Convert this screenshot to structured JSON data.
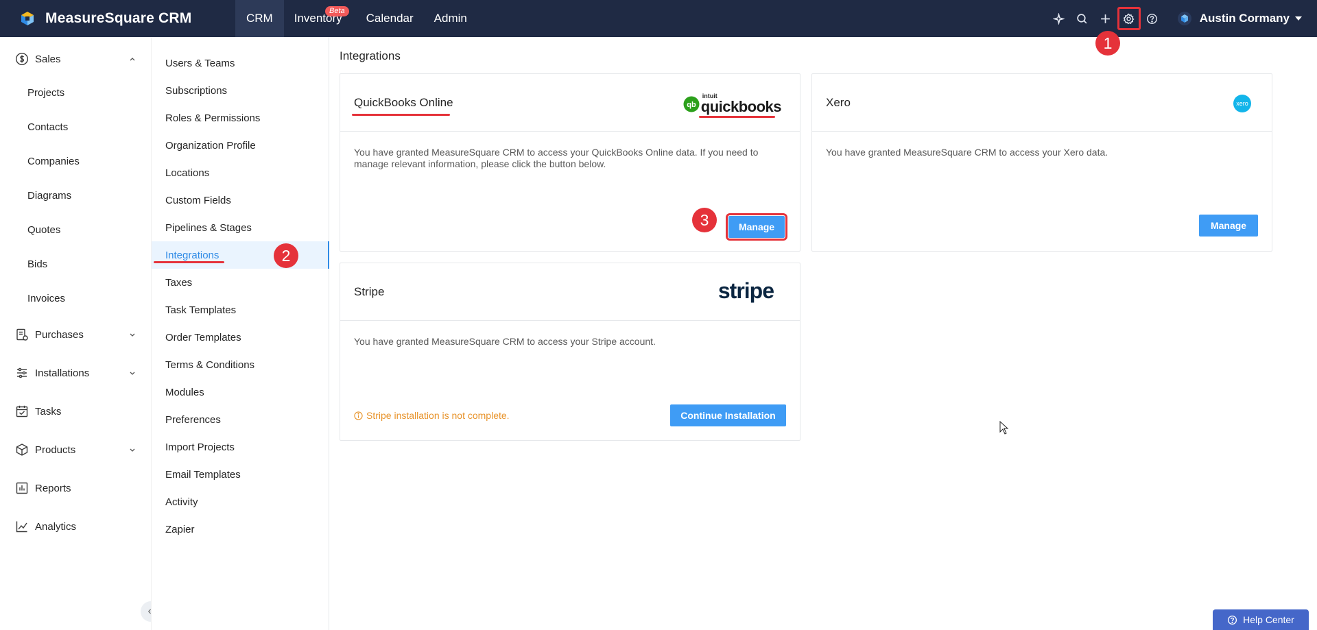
{
  "app": {
    "title": "MeasureSquare CRM"
  },
  "topnav": {
    "items": [
      "CRM",
      "Inventory",
      "Calendar",
      "Admin"
    ],
    "beta_badge": "Beta"
  },
  "user": {
    "name": "Austin Cormany"
  },
  "steps": [
    "1",
    "2",
    "3"
  ],
  "sidebar": {
    "sales": "Sales",
    "sales_items": [
      "Projects",
      "Contacts",
      "Companies",
      "Diagrams",
      "Quotes",
      "Bids",
      "Invoices"
    ],
    "purchases": "Purchases",
    "installations": "Installations",
    "tasks": "Tasks",
    "products": "Products",
    "reports": "Reports",
    "analytics": "Analytics"
  },
  "settings_menu": {
    "items": [
      "Users & Teams",
      "Subscriptions",
      "Roles & Permissions",
      "Organization Profile",
      "Locations",
      "Custom Fields",
      "Pipelines & Stages",
      "Integrations",
      "Taxes",
      "Task Templates",
      "Order Templates",
      "Terms & Conditions",
      "Modules",
      "Preferences",
      "Import Projects",
      "Email Templates",
      "Activity",
      "Zapier"
    ],
    "active": "Integrations"
  },
  "main": {
    "title": "Integrations",
    "quickbooks": {
      "title": "QuickBooks Online",
      "logo_small": "intuit",
      "logo_text": "quickbooks",
      "description": "You have granted MeasureSquare CRM to access your QuickBooks Online data. If you need to manage relevant information, please click the button below.",
      "button": "Manage"
    },
    "xero": {
      "title": "Xero",
      "logo_text": "xero",
      "description": "You have granted MeasureSquare CRM to access your Xero data.",
      "button": "Manage"
    },
    "stripe": {
      "title": "Stripe",
      "logo_text": "stripe",
      "description": "You have granted MeasureSquare CRM to access your Stripe account.",
      "warning": "Stripe installation is not complete.",
      "button": "Continue Installation"
    }
  },
  "help_center": "Help Center",
  "colors": {
    "topbar": "#1f2a44",
    "accent": "#3f9cf5",
    "annotation": "#e5323a",
    "warning": "#e8932a"
  }
}
